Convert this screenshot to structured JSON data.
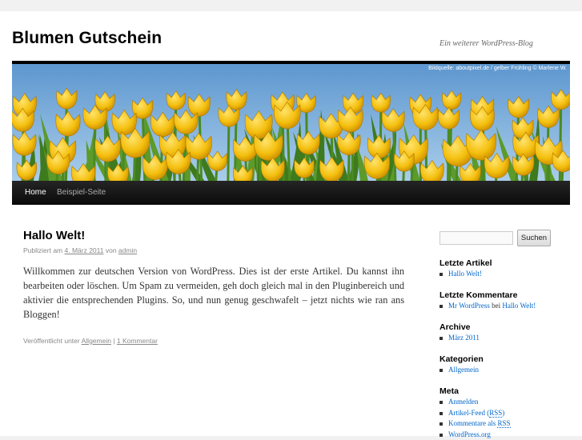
{
  "site": {
    "title": "Blumen Gutschein",
    "description": "Ein weiterer WordPress-Blog",
    "banner_credit": "Bildquelle: aboutpixel.de / gelber Frühling © Marlene W."
  },
  "nav": {
    "items": [
      {
        "label": "Home",
        "current": true
      },
      {
        "label": "Beispiel-Seite",
        "current": false
      }
    ]
  },
  "post": {
    "title": "Hallo Welt!",
    "meta_prefix": "Publiziert am ",
    "date": "4. März 2011",
    "meta_by": " von ",
    "author": "admin",
    "content": "Willkommen zur deutschen Version von WordPress. Dies ist der erste Artikel. Du kannst ihn bearbeiten oder löschen. Um Spam zu vermeiden, geh doch gleich mal in den Pluginbereich und aktivier die entsprechenden Plugins. So, und nun genug geschwafelt – jetzt nichts wie ran ans Bloggen!",
    "utility_prefix": "Veröffentlicht unter ",
    "category": "Allgemein",
    "separator": " | ",
    "comments": "1 Kommentar"
  },
  "sidebar": {
    "search_placeholder": "",
    "search_button": "Suchen",
    "recent_posts_title": "Letzte Artikel",
    "recent_posts": [
      "Hallo Welt!"
    ],
    "recent_comments_title": "Letzte Kommentare",
    "recent_comment": {
      "author": "Mr WordPress",
      "bei": " bei ",
      "post": "Hallo Welt!"
    },
    "archives_title": "Archive",
    "archives": [
      "März 2011"
    ],
    "categories_title": "Kategorien",
    "categories": [
      "Allgemein"
    ],
    "meta_title": "Meta",
    "meta_login": "Anmelden",
    "meta_feed": "Artikel-Feed (",
    "meta_feed_abbr": "RSS",
    "meta_feed_end": ")",
    "meta_comments": "Kommentare als ",
    "meta_comments_abbr": "RSS",
    "meta_wp": "WordPress.org"
  },
  "colors": {
    "link": "#0066cc",
    "tulip_yellow": "#f4c20d",
    "sky": "#6fa7d9"
  }
}
